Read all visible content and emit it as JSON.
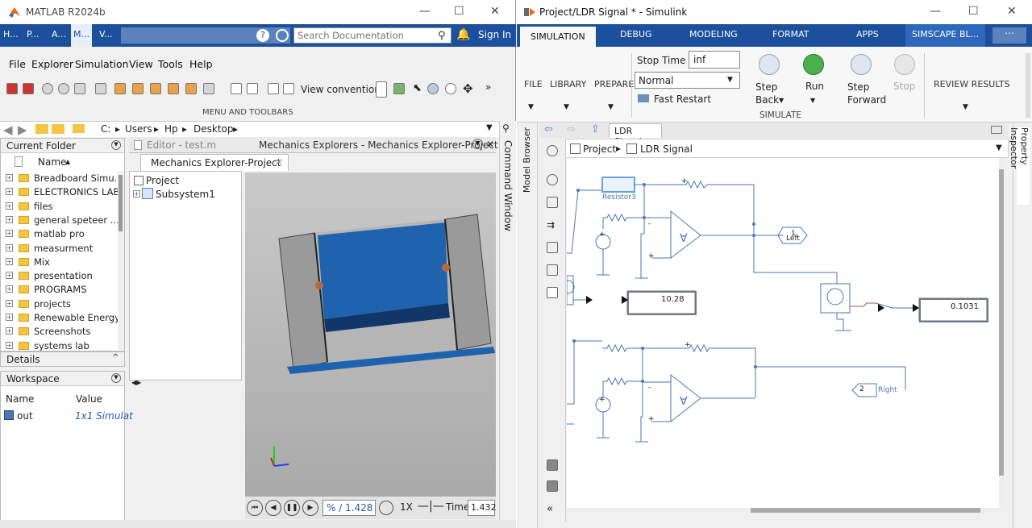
{
  "matlab": {
    "title": "MATLAB R2024b",
    "tabs": [
      "H...",
      "P...",
      "A...",
      "M...",
      "V..."
    ],
    "search_placeholder": "Search Documentation",
    "sign_in": "Sign In",
    "menu": [
      "File",
      "Explorer",
      "Simulation",
      "View",
      "Tools",
      "Help"
    ],
    "view_convention_label": "View convention:",
    "menu_and_toolbars": "MENU AND TOOLBARS",
    "path": [
      "C:",
      "Users",
      "Hp",
      "Desktop"
    ],
    "current_folder_title": "Current Folder",
    "name_col": "Name",
    "folders": [
      "Breadboard Simu...",
      "ELECTRONICS LAB",
      "files",
      "general speteer ...",
      "matlab pro",
      "measurment",
      "Mix",
      "presentation",
      "PROGRAMS",
      "projects",
      "Renewable Energy",
      "Screenshots",
      "systems lab"
    ],
    "details_title": "Details",
    "workspace_title": "Workspace",
    "ws_name_col": "Name",
    "ws_value_col": "Value",
    "ws_var_name": "out",
    "ws_var_value": "1x1 Simulat",
    "editor_tab": "Editor - test.m",
    "mech_tab": "Mechanics Explorers - Mechanics Explorer-Project",
    "mech_subtab": "Mechanics Explorer-Project",
    "tree_project": "Project",
    "tree_subsystem": "Subsystem1",
    "command_window": "Command Window",
    "progress": "% / 1.428",
    "speed": "1X",
    "time_label": "Time",
    "time_value": "1.432"
  },
  "simulink": {
    "title": "Project/LDR Signal * - Simulink",
    "tabs": [
      "SIMULATION",
      "DEBUG",
      "MODELING",
      "FORMAT",
      "APPS",
      "SIMSCAPE BL..."
    ],
    "file": "FILE",
    "library": "LIBRARY",
    "prepare": "PREPARE",
    "stop_time_label": "Stop Time",
    "stop_time_value": "inf",
    "mode": "Normal",
    "fast_restart": "Fast Restart",
    "step_back": "Step Back",
    "run": "Run",
    "step_forward": "Step Forward",
    "stop": "Stop",
    "simulate": "SIMULATE",
    "review_results": "REVIEW RESULTS",
    "model_tab": "LDR Signal",
    "breadcrumb_project": "Project",
    "breadcrumb_model": "LDR Signal",
    "model_browser": "Model Browser",
    "property_inspector": "Property Inspector",
    "resistor_label": "Resistor3",
    "port1_num": "1",
    "port1_name": "Left",
    "port2_num": "2",
    "port2_name": "Right",
    "display1": "10.28",
    "display2": "0.1031"
  }
}
